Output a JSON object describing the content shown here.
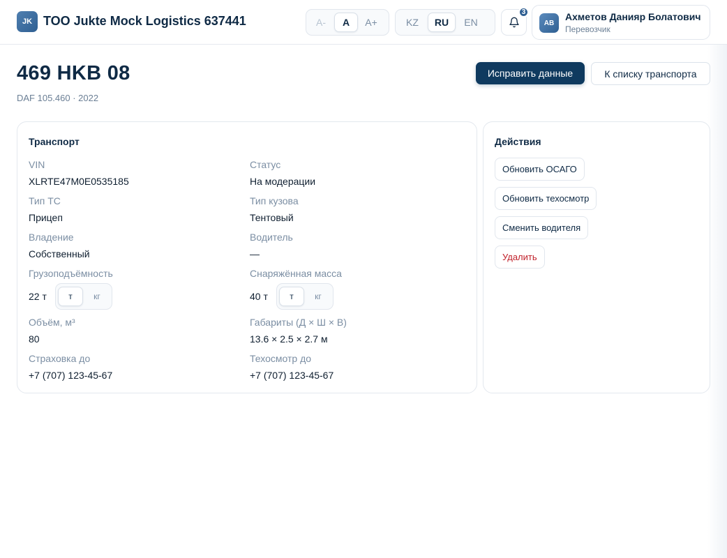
{
  "header": {
    "logo_text": "JK",
    "app_title": "TOO Jukte Mock Logistics 637441",
    "font_size_options": [
      {
        "label": "A-",
        "state": "disabled"
      },
      {
        "label": "A",
        "state": "active"
      },
      {
        "label": "A+",
        "state": "normal"
      }
    ],
    "languages": [
      {
        "label": "KZ",
        "state": "normal"
      },
      {
        "label": "RU",
        "state": "active"
      },
      {
        "label": "EN",
        "state": "normal"
      }
    ],
    "notifications_count": "3",
    "user": {
      "initials": "AB",
      "name": "Ахметов Данияр Болатович",
      "role": "Перевозчик"
    }
  },
  "vehicle": {
    "plate": "469 HKB 08",
    "subtitle": "DAF 105.460 · 2022"
  },
  "buttons": {
    "edit": "Исправить данные",
    "back": "К списку транспорта"
  },
  "transport_card": {
    "title": "Транспорт",
    "fields": {
      "vin": {
        "label": "VIN",
        "value": "XLRTE47M0E0535185"
      },
      "status": {
        "label": "Статус",
        "value": "На модерации"
      },
      "vehicle_type": {
        "label": "Тип ТС",
        "value": "Прицеп"
      },
      "body_type": {
        "label": "Тип кузова",
        "value": "Тентовый"
      },
      "ownership": {
        "label": "Владение",
        "value": "Собственный"
      },
      "driver": {
        "label": "Водитель",
        "value": "—"
      },
      "capacity": {
        "label": "Грузоподъёмность",
        "value": "22 т"
      },
      "curb_weight": {
        "label": "Снаряжённая масса",
        "value": "40 т"
      },
      "volume": {
        "label": "Объём, м³",
        "value": "80"
      },
      "dimensions": {
        "label": "Габариты (Д × Ш × В)",
        "value": "13.6 × 2.5 × 2.7 м"
      },
      "insurance": {
        "label": "Страховка до",
        "value": "+7 (707) 123-45-67"
      },
      "inspection": {
        "label": "Техосмотр до",
        "value": "+7 (707) 123-45-67"
      }
    },
    "unit_options": [
      "т",
      "кг"
    ],
    "unit_selected": "т"
  },
  "actions_card": {
    "title": "Действия",
    "actions": [
      {
        "label": "Обновить ОСАГО"
      },
      {
        "label": "Обновить техосмотр"
      },
      {
        "label": "Сменить водителя"
      },
      {
        "label": "Удалить",
        "danger": true
      }
    ]
  },
  "colors": {
    "primary": "#0f3a5f",
    "text": "#0f2a45",
    "muted": "#7b8ea3",
    "danger": "#c0202a",
    "border": "#e3e8ee"
  }
}
